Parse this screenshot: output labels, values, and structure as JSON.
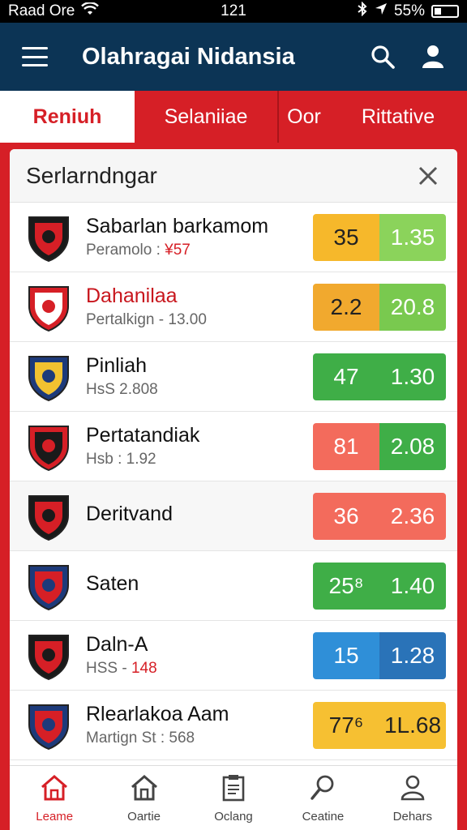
{
  "status_bar": {
    "carrier": "Raad Ore",
    "time": "121",
    "battery": "55%",
    "wifi_icon": "wifi-icon",
    "location_icon": "location-arrow-icon"
  },
  "app": {
    "title": "Olahragai Nidansia",
    "menu_icon": "hamburger-icon",
    "search_icon": "search-icon",
    "profile_icon": "user-icon"
  },
  "tabs": [
    {
      "label": "Reniuh",
      "active": true
    },
    {
      "label": "Selaniiae",
      "active": false
    },
    {
      "label": "Oor",
      "active": false
    },
    {
      "label": "Rittative",
      "active": false
    }
  ],
  "panel": {
    "title": "Serlarndngar",
    "close_icon": "close-icon"
  },
  "matches": [
    {
      "name": "Sabarlan barkamom",
      "sub_prefix": "Peramolo : ",
      "sub_highlight": "¥57",
      "odd1": "35",
      "odd2": "1.35",
      "c1": "#f6b82b",
      "c2": "#8bd35b",
      "name_red": false
    },
    {
      "name": "Dahanilaa",
      "sub_prefix": "Pertalkign - 13.00",
      "sub_highlight": "",
      "odd1": "2.2",
      "odd2": "20.8",
      "c1": "#f1a92e",
      "c2": "#79c94f",
      "name_red": true
    },
    {
      "name": "Pinliah",
      "sub_prefix": "HsS 2.808",
      "sub_highlight": "",
      "odd1": "47",
      "odd2": "1.30",
      "c1": "#3fae47",
      "c2": "#3fae47",
      "name_red": false
    },
    {
      "name": "Pertatandiak",
      "sub_prefix": "Hsb : 1.92",
      "sub_highlight": "",
      "odd1": "81",
      "odd2": "2.08",
      "c1": "#f36b5c",
      "c2": "#3fae47",
      "name_red": false
    },
    {
      "name": "Deritvand",
      "sub_prefix": "",
      "sub_highlight": "",
      "odd1": "36",
      "odd2": "2.36",
      "c1": "#f36b5c",
      "c2": "#f36b5c",
      "name_red": false
    },
    {
      "name": "Saten",
      "sub_prefix": "",
      "sub_highlight": "",
      "odd1": "25⁸",
      "odd2": "1.40",
      "c1": "#3fae47",
      "c2": "#3fae47",
      "name_red": false
    },
    {
      "name": "Daln-A",
      "sub_prefix": "HSS - ",
      "sub_highlight": "148",
      "odd1": "15",
      "odd2": "1.28",
      "c1": "#2f8fd8",
      "c2": "#2a73b8",
      "name_red": false
    },
    {
      "name": "Rlearlakoa Aam",
      "sub_prefix": "Martign St : 568",
      "sub_highlight": "",
      "odd1": "77⁶",
      "odd2": "1L.68",
      "c1": "#f6c032",
      "c2": "#f6c032",
      "name_red": false
    }
  ],
  "bottom_nav": [
    {
      "label": "Leame",
      "icon": "home-icon",
      "active": true
    },
    {
      "label": "Oartie",
      "icon": "house-icon",
      "active": false
    },
    {
      "label": "Oclang",
      "icon": "clipboard-icon",
      "active": false
    },
    {
      "label": "Ceatine",
      "icon": "search-icon",
      "active": false
    },
    {
      "label": "Dehars",
      "icon": "user-icon",
      "active": false
    }
  ]
}
